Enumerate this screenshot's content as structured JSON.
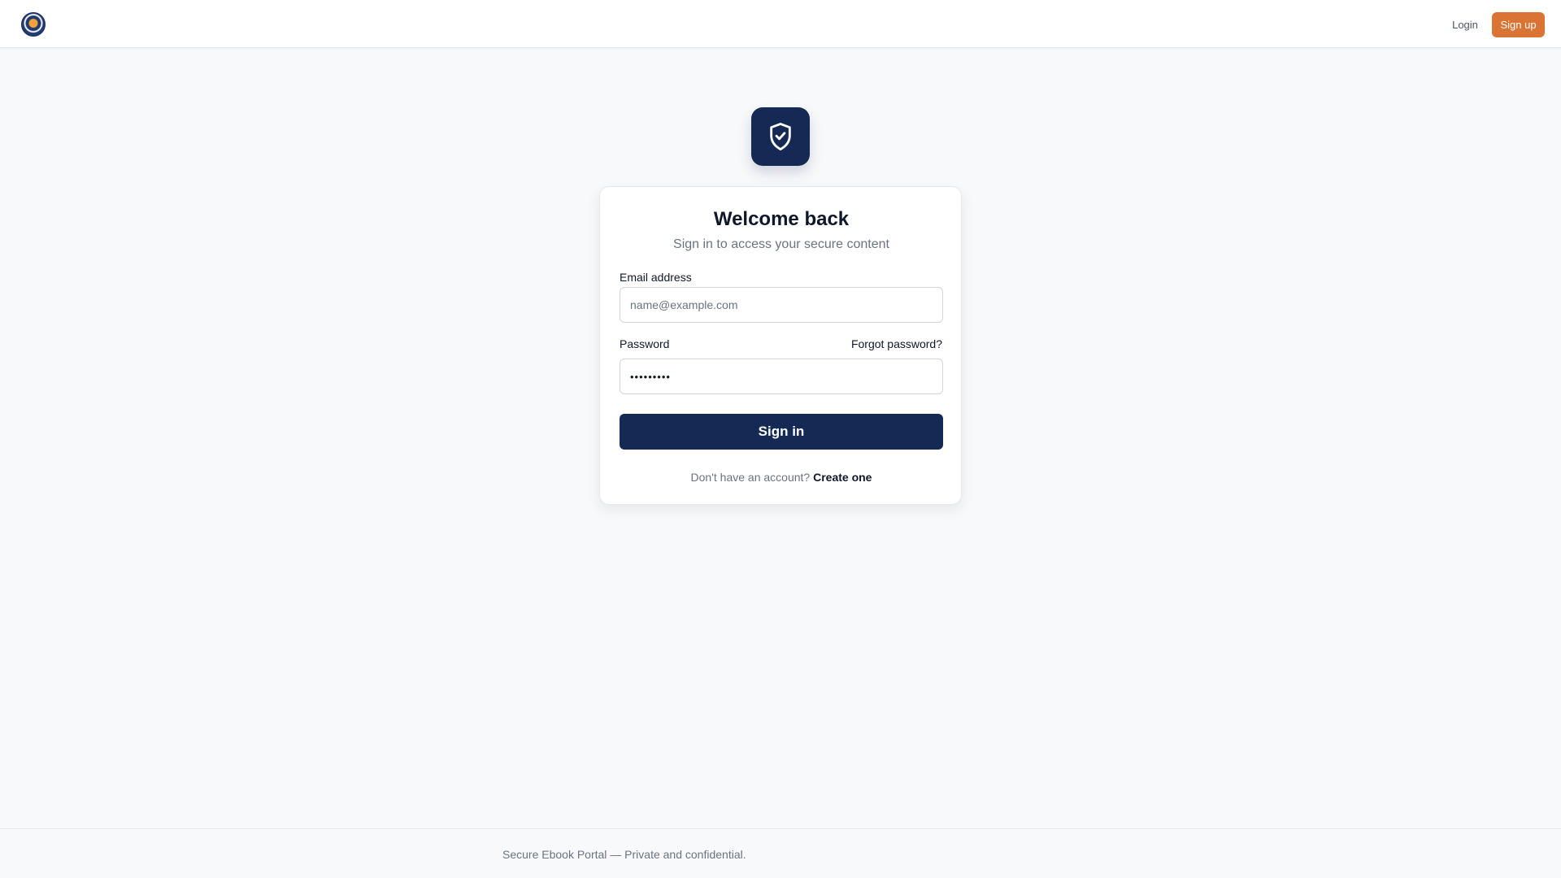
{
  "header": {
    "login_label": "Login",
    "signup_label": "Sign up",
    "logo_icon": "emblem-logo-icon"
  },
  "card": {
    "badge_icon": "shield-check-icon",
    "title": "Welcome back",
    "subtitle": "Sign in to access your secure content",
    "email": {
      "label": "Email address",
      "placeholder": "name@example.com",
      "value": ""
    },
    "password": {
      "label": "Password",
      "value": "•••••••••",
      "forgot_label": "Forgot password?"
    },
    "signin_label": "Sign in",
    "no_account_text": "Don't have an account?",
    "create_label": "Create one"
  },
  "footer": {
    "text": "Secure Ebook Portal — Private and confidential."
  },
  "colors": {
    "primary_navy": "#142a54",
    "accent_orange": "#d97434",
    "background": "#f8f9fb"
  }
}
